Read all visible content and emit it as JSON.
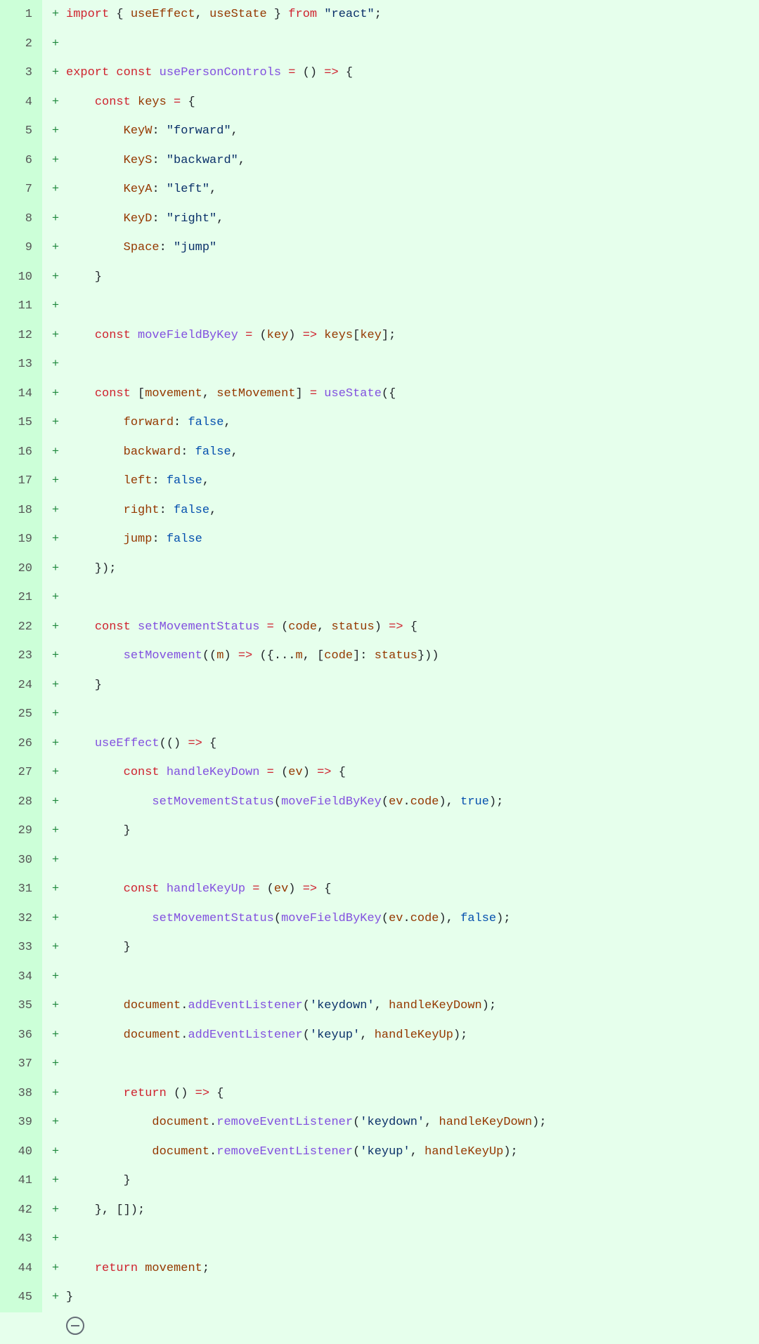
{
  "diff_marker": "+",
  "footer_icon_name": "collapse-icon",
  "lines": [
    {
      "num": 1,
      "tokens": [
        [
          "kw",
          "import"
        ],
        [
          "plain",
          " { "
        ],
        [
          "var",
          "useEffect"
        ],
        [
          "plain",
          ", "
        ],
        [
          "var",
          "useState"
        ],
        [
          "plain",
          " } "
        ],
        [
          "kw",
          "from"
        ],
        [
          "plain",
          " "
        ],
        [
          "str",
          "\"react\""
        ],
        [
          "plain",
          ";"
        ]
      ]
    },
    {
      "num": 2,
      "tokens": [
        [
          "plain",
          ""
        ]
      ]
    },
    {
      "num": 3,
      "tokens": [
        [
          "kw",
          "export"
        ],
        [
          "plain",
          " "
        ],
        [
          "kw",
          "const"
        ],
        [
          "plain",
          " "
        ],
        [
          "fn",
          "usePersonControls"
        ],
        [
          "plain",
          " "
        ],
        [
          "kw",
          "="
        ],
        [
          "plain",
          " () "
        ],
        [
          "kw",
          "=>"
        ],
        [
          "plain",
          " {"
        ]
      ]
    },
    {
      "num": 4,
      "tokens": [
        [
          "plain",
          "    "
        ],
        [
          "kw",
          "const"
        ],
        [
          "plain",
          " "
        ],
        [
          "var",
          "keys"
        ],
        [
          "plain",
          " "
        ],
        [
          "kw",
          "="
        ],
        [
          "plain",
          " {"
        ]
      ]
    },
    {
      "num": 5,
      "tokens": [
        [
          "plain",
          "        "
        ],
        [
          "var",
          "KeyW"
        ],
        [
          "plain",
          ": "
        ],
        [
          "str",
          "\"forward\""
        ],
        [
          "plain",
          ","
        ]
      ]
    },
    {
      "num": 6,
      "tokens": [
        [
          "plain",
          "        "
        ],
        [
          "var",
          "KeyS"
        ],
        [
          "plain",
          ": "
        ],
        [
          "str",
          "\"backward\""
        ],
        [
          "plain",
          ","
        ]
      ]
    },
    {
      "num": 7,
      "tokens": [
        [
          "plain",
          "        "
        ],
        [
          "var",
          "KeyA"
        ],
        [
          "plain",
          ": "
        ],
        [
          "str",
          "\"left\""
        ],
        [
          "plain",
          ","
        ]
      ]
    },
    {
      "num": 8,
      "tokens": [
        [
          "plain",
          "        "
        ],
        [
          "var",
          "KeyD"
        ],
        [
          "plain",
          ": "
        ],
        [
          "str",
          "\"right\""
        ],
        [
          "plain",
          ","
        ]
      ]
    },
    {
      "num": 9,
      "tokens": [
        [
          "plain",
          "        "
        ],
        [
          "var",
          "Space"
        ],
        [
          "plain",
          ": "
        ],
        [
          "str",
          "\"jump\""
        ]
      ]
    },
    {
      "num": 10,
      "tokens": [
        [
          "plain",
          "    }"
        ]
      ]
    },
    {
      "num": 11,
      "tokens": [
        [
          "plain",
          ""
        ]
      ]
    },
    {
      "num": 12,
      "tokens": [
        [
          "plain",
          "    "
        ],
        [
          "kw",
          "const"
        ],
        [
          "plain",
          " "
        ],
        [
          "fn",
          "moveFieldByKey"
        ],
        [
          "plain",
          " "
        ],
        [
          "kw",
          "="
        ],
        [
          "plain",
          " ("
        ],
        [
          "var",
          "key"
        ],
        [
          "plain",
          ") "
        ],
        [
          "kw",
          "=>"
        ],
        [
          "plain",
          " "
        ],
        [
          "var",
          "keys"
        ],
        [
          "plain",
          "["
        ],
        [
          "var",
          "key"
        ],
        [
          "plain",
          "];"
        ]
      ]
    },
    {
      "num": 13,
      "tokens": [
        [
          "plain",
          ""
        ]
      ]
    },
    {
      "num": 14,
      "tokens": [
        [
          "plain",
          "    "
        ],
        [
          "kw",
          "const"
        ],
        [
          "plain",
          " ["
        ],
        [
          "var",
          "movement"
        ],
        [
          "plain",
          ", "
        ],
        [
          "var",
          "setMovement"
        ],
        [
          "plain",
          "] "
        ],
        [
          "kw",
          "="
        ],
        [
          "plain",
          " "
        ],
        [
          "fn",
          "useState"
        ],
        [
          "plain",
          "({"
        ]
      ]
    },
    {
      "num": 15,
      "tokens": [
        [
          "plain",
          "        "
        ],
        [
          "var",
          "forward"
        ],
        [
          "plain",
          ": "
        ],
        [
          "const",
          "false"
        ],
        [
          "plain",
          ","
        ]
      ]
    },
    {
      "num": 16,
      "tokens": [
        [
          "plain",
          "        "
        ],
        [
          "var",
          "backward"
        ],
        [
          "plain",
          ": "
        ],
        [
          "const",
          "false"
        ],
        [
          "plain",
          ","
        ]
      ]
    },
    {
      "num": 17,
      "tokens": [
        [
          "plain",
          "        "
        ],
        [
          "var",
          "left"
        ],
        [
          "plain",
          ": "
        ],
        [
          "const",
          "false"
        ],
        [
          "plain",
          ","
        ]
      ]
    },
    {
      "num": 18,
      "tokens": [
        [
          "plain",
          "        "
        ],
        [
          "var",
          "right"
        ],
        [
          "plain",
          ": "
        ],
        [
          "const",
          "false"
        ],
        [
          "plain",
          ","
        ]
      ]
    },
    {
      "num": 19,
      "tokens": [
        [
          "plain",
          "        "
        ],
        [
          "var",
          "jump"
        ],
        [
          "plain",
          ": "
        ],
        [
          "const",
          "false"
        ]
      ]
    },
    {
      "num": 20,
      "tokens": [
        [
          "plain",
          "    });"
        ]
      ]
    },
    {
      "num": 21,
      "tokens": [
        [
          "plain",
          ""
        ]
      ]
    },
    {
      "num": 22,
      "tokens": [
        [
          "plain",
          "    "
        ],
        [
          "kw",
          "const"
        ],
        [
          "plain",
          " "
        ],
        [
          "fn",
          "setMovementStatus"
        ],
        [
          "plain",
          " "
        ],
        [
          "kw",
          "="
        ],
        [
          "plain",
          " ("
        ],
        [
          "var",
          "code"
        ],
        [
          "plain",
          ", "
        ],
        [
          "var",
          "status"
        ],
        [
          "plain",
          ") "
        ],
        [
          "kw",
          "=>"
        ],
        [
          "plain",
          " {"
        ]
      ]
    },
    {
      "num": 23,
      "tokens": [
        [
          "plain",
          "        "
        ],
        [
          "fn",
          "setMovement"
        ],
        [
          "plain",
          "(("
        ],
        [
          "var",
          "m"
        ],
        [
          "plain",
          ") "
        ],
        [
          "kw",
          "=>"
        ],
        [
          "plain",
          " ({..."
        ],
        [
          "var",
          "m"
        ],
        [
          "plain",
          ", ["
        ],
        [
          "var",
          "code"
        ],
        [
          "plain",
          "]: "
        ],
        [
          "var",
          "status"
        ],
        [
          "plain",
          "}))"
        ]
      ]
    },
    {
      "num": 24,
      "tokens": [
        [
          "plain",
          "    }"
        ]
      ]
    },
    {
      "num": 25,
      "tokens": [
        [
          "plain",
          ""
        ]
      ]
    },
    {
      "num": 26,
      "tokens": [
        [
          "plain",
          "    "
        ],
        [
          "fn",
          "useEffect"
        ],
        [
          "plain",
          "(() "
        ],
        [
          "kw",
          "=>"
        ],
        [
          "plain",
          " {"
        ]
      ]
    },
    {
      "num": 27,
      "tokens": [
        [
          "plain",
          "        "
        ],
        [
          "kw",
          "const"
        ],
        [
          "plain",
          " "
        ],
        [
          "fn",
          "handleKeyDown"
        ],
        [
          "plain",
          " "
        ],
        [
          "kw",
          "="
        ],
        [
          "plain",
          " ("
        ],
        [
          "var",
          "ev"
        ],
        [
          "plain",
          ") "
        ],
        [
          "kw",
          "=>"
        ],
        [
          "plain",
          " {"
        ]
      ]
    },
    {
      "num": 28,
      "tokens": [
        [
          "plain",
          "            "
        ],
        [
          "fn",
          "setMovementStatus"
        ],
        [
          "plain",
          "("
        ],
        [
          "fn",
          "moveFieldByKey"
        ],
        [
          "plain",
          "("
        ],
        [
          "var",
          "ev"
        ],
        [
          "plain",
          "."
        ],
        [
          "var",
          "code"
        ],
        [
          "plain",
          "), "
        ],
        [
          "const",
          "true"
        ],
        [
          "plain",
          ");"
        ]
      ]
    },
    {
      "num": 29,
      "tokens": [
        [
          "plain",
          "        }"
        ]
      ]
    },
    {
      "num": 30,
      "tokens": [
        [
          "plain",
          ""
        ]
      ]
    },
    {
      "num": 31,
      "tokens": [
        [
          "plain",
          "        "
        ],
        [
          "kw",
          "const"
        ],
        [
          "plain",
          " "
        ],
        [
          "fn",
          "handleKeyUp"
        ],
        [
          "plain",
          " "
        ],
        [
          "kw",
          "="
        ],
        [
          "plain",
          " ("
        ],
        [
          "var",
          "ev"
        ],
        [
          "plain",
          ") "
        ],
        [
          "kw",
          "=>"
        ],
        [
          "plain",
          " {"
        ]
      ]
    },
    {
      "num": 32,
      "tokens": [
        [
          "plain",
          "            "
        ],
        [
          "fn",
          "setMovementStatus"
        ],
        [
          "plain",
          "("
        ],
        [
          "fn",
          "moveFieldByKey"
        ],
        [
          "plain",
          "("
        ],
        [
          "var",
          "ev"
        ],
        [
          "plain",
          "."
        ],
        [
          "var",
          "code"
        ],
        [
          "plain",
          "), "
        ],
        [
          "const",
          "false"
        ],
        [
          "plain",
          ");"
        ]
      ]
    },
    {
      "num": 33,
      "tokens": [
        [
          "plain",
          "        }"
        ]
      ]
    },
    {
      "num": 34,
      "tokens": [
        [
          "plain",
          ""
        ]
      ]
    },
    {
      "num": 35,
      "tokens": [
        [
          "plain",
          "        "
        ],
        [
          "var",
          "document"
        ],
        [
          "plain",
          "."
        ],
        [
          "fn",
          "addEventListener"
        ],
        [
          "plain",
          "("
        ],
        [
          "str",
          "'keydown'"
        ],
        [
          "plain",
          ", "
        ],
        [
          "var",
          "handleKeyDown"
        ],
        [
          "plain",
          ");"
        ]
      ]
    },
    {
      "num": 36,
      "tokens": [
        [
          "plain",
          "        "
        ],
        [
          "var",
          "document"
        ],
        [
          "plain",
          "."
        ],
        [
          "fn",
          "addEventListener"
        ],
        [
          "plain",
          "("
        ],
        [
          "str",
          "'keyup'"
        ],
        [
          "plain",
          ", "
        ],
        [
          "var",
          "handleKeyUp"
        ],
        [
          "plain",
          ");"
        ]
      ]
    },
    {
      "num": 37,
      "tokens": [
        [
          "plain",
          ""
        ]
      ]
    },
    {
      "num": 38,
      "tokens": [
        [
          "plain",
          "        "
        ],
        [
          "kw",
          "return"
        ],
        [
          "plain",
          " () "
        ],
        [
          "kw",
          "=>"
        ],
        [
          "plain",
          " {"
        ]
      ]
    },
    {
      "num": 39,
      "tokens": [
        [
          "plain",
          "            "
        ],
        [
          "var",
          "document"
        ],
        [
          "plain",
          "."
        ],
        [
          "fn",
          "removeEventListener"
        ],
        [
          "plain",
          "("
        ],
        [
          "str",
          "'keydown'"
        ],
        [
          "plain",
          ", "
        ],
        [
          "var",
          "handleKeyDown"
        ],
        [
          "plain",
          ");"
        ]
      ]
    },
    {
      "num": 40,
      "tokens": [
        [
          "plain",
          "            "
        ],
        [
          "var",
          "document"
        ],
        [
          "plain",
          "."
        ],
        [
          "fn",
          "removeEventListener"
        ],
        [
          "plain",
          "("
        ],
        [
          "str",
          "'keyup'"
        ],
        [
          "plain",
          ", "
        ],
        [
          "var",
          "handleKeyUp"
        ],
        [
          "plain",
          ");"
        ]
      ]
    },
    {
      "num": 41,
      "tokens": [
        [
          "plain",
          "        }"
        ]
      ]
    },
    {
      "num": 42,
      "tokens": [
        [
          "plain",
          "    }, []);"
        ]
      ]
    },
    {
      "num": 43,
      "tokens": [
        [
          "plain",
          ""
        ]
      ]
    },
    {
      "num": 44,
      "tokens": [
        [
          "plain",
          "    "
        ],
        [
          "kw",
          "return"
        ],
        [
          "plain",
          " "
        ],
        [
          "var",
          "movement"
        ],
        [
          "plain",
          ";"
        ]
      ]
    },
    {
      "num": 45,
      "tokens": [
        [
          "plain",
          "}"
        ]
      ]
    }
  ]
}
